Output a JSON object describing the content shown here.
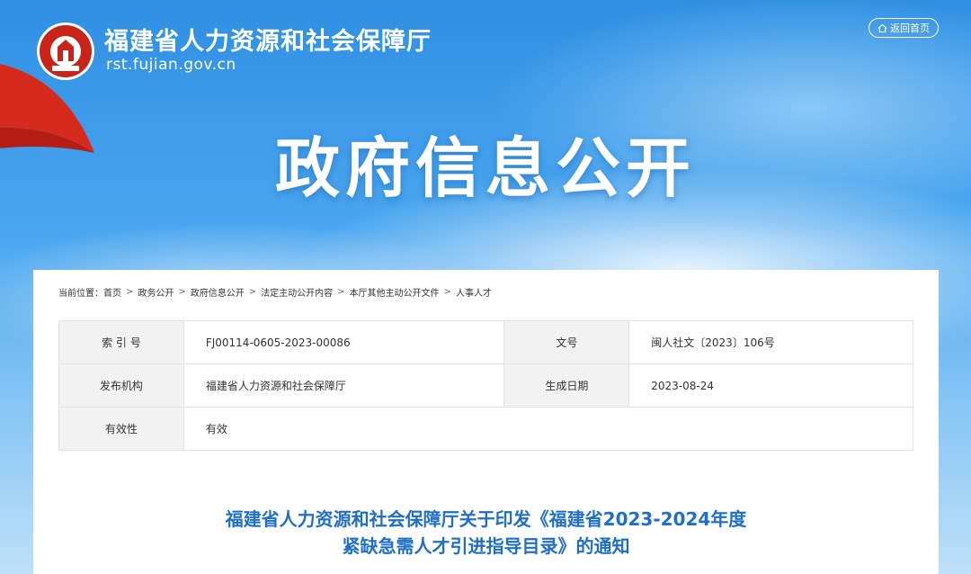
{
  "header": {
    "site_name": "福建省人力资源和社会保障厅",
    "site_domain": "rst.fujian.gov.cn",
    "home_button": "返回首页",
    "hero_title": "政府信息公开"
  },
  "breadcrumb": {
    "prefix": "当前位置：",
    "items": [
      "首页",
      "政务公开",
      "政府信息公开",
      "法定主动公开内容",
      "本厅其他主动公开文件",
      "人事人才"
    ]
  },
  "meta": {
    "index_label": "索 引 号",
    "index_value": "FJ00114-0605-2023-00086",
    "docno_label": "文号",
    "docno_value": "闽人社文〔2023〕106号",
    "issuer_label": "发布机构",
    "issuer_value": "福建省人力资源和社会保障厅",
    "date_label": "生成日期",
    "date_value": "2023-08-24",
    "validity_label": "有效性",
    "validity_value": "有效"
  },
  "document": {
    "title_line1": "福建省人力资源和社会保障厅关于印发《福建省2023-2024年度",
    "title_line2": "紧缺急需人才引进指导目录》的通知"
  },
  "colors": {
    "sky": "#3d9be8",
    "title_blue": "#1f6fc7",
    "flag_red": "#d62a1e"
  }
}
